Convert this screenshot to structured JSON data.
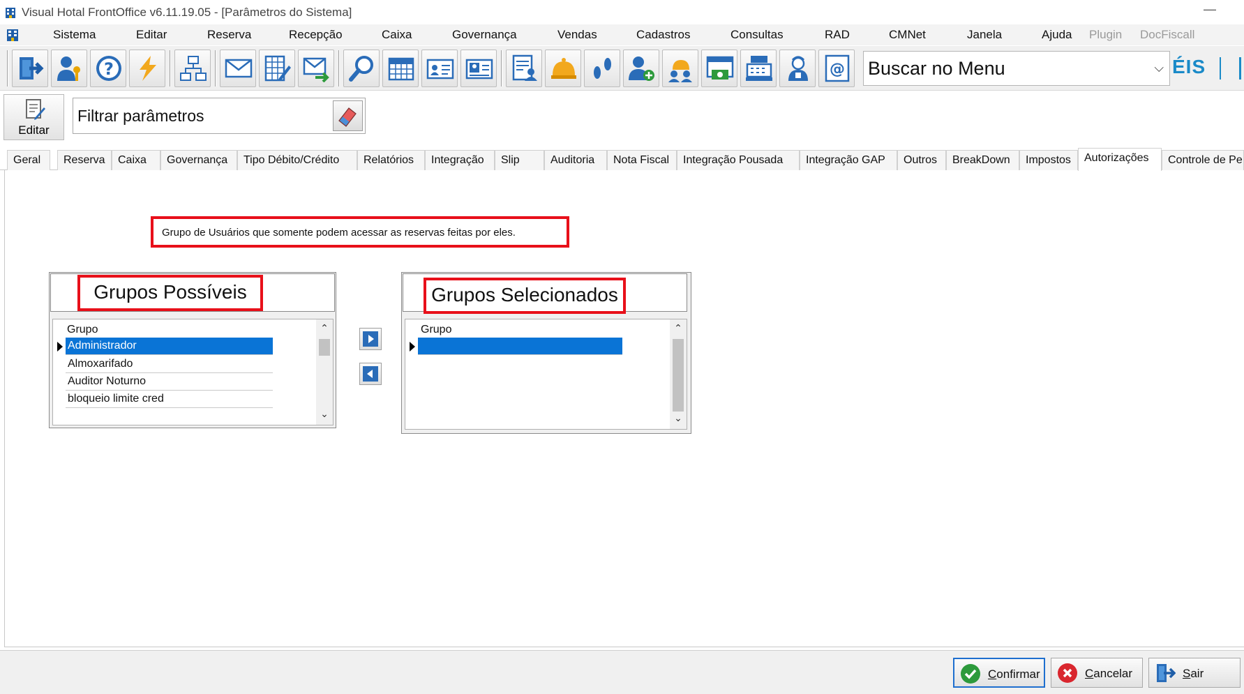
{
  "window": {
    "title": "Visual Hotal FrontOffice v6.11.19.05 - [Parâmetros do Sistema]",
    "minimize": "—"
  },
  "menu": {
    "items": [
      "Sistema",
      "Editar",
      "Reserva",
      "Recepção",
      "Caixa",
      "Governança",
      "Vendas",
      "Cadastros",
      "Consultas",
      "RAD",
      "CMNet",
      "Janela",
      "Ajuda"
    ],
    "disabled_items": [
      "Plugin",
      "DocFiscall"
    ]
  },
  "toolbar": {
    "menu_search_value": "Buscar no Menu",
    "eis_label": "ÉIS",
    "icons": [
      "exit-icon",
      "user-key-icon",
      "help-icon",
      "lightning-icon",
      "network-icon",
      "mail-icon",
      "edit-sheet-icon",
      "send-mail-icon",
      "search-icon",
      "calendar-icon",
      "guest-card-icon",
      "guest-card-photo-icon",
      "report-user-icon",
      "bell-icon",
      "footprints-icon",
      "add-user-icon",
      "group-icon",
      "cash-register-icon",
      "cashier-machine-icon",
      "maid-icon",
      "email-at-icon"
    ]
  },
  "params": {
    "edit_label": "Editar",
    "filter_value": "Filtrar parâmetros"
  },
  "tabs": [
    "Geral",
    "Reserva",
    "Caixa",
    "Governança",
    "Tipo Débito/Crédito",
    "Relatórios",
    "Integração",
    "Slip",
    "Auditoria",
    "Nota Fiscal",
    "Integração Pousada",
    "Integração GAP",
    "Outros",
    "BreakDown",
    "Impostos",
    "Autorizações",
    "Controle de Pe"
  ],
  "active_tab": "Autorizações",
  "authorizations": {
    "description": "Grupo de Usuários que somente podem acessar as reservas feitas por eles.",
    "possible": {
      "title": "Grupos Possíveis",
      "column": "Grupo",
      "rows": [
        "Administrador",
        "Almoxarifado",
        "Auditor Noturno",
        "bloqueio limite cred"
      ],
      "selected_row": 0
    },
    "selected": {
      "title": "Grupos Selecionados",
      "column": "Grupo",
      "rows": [
        ""
      ],
      "selected_row": 0
    }
  },
  "footer": {
    "confirm_prefix": "C",
    "confirm_rest": "onfirmar",
    "cancel_prefix": "C",
    "cancel_rest": "ancelar",
    "exit_prefix": "S",
    "exit_rest": "air"
  },
  "colors": {
    "highlight": "#e8101a",
    "selection": "#0a74d6",
    "accent": "#1a8ac8"
  }
}
